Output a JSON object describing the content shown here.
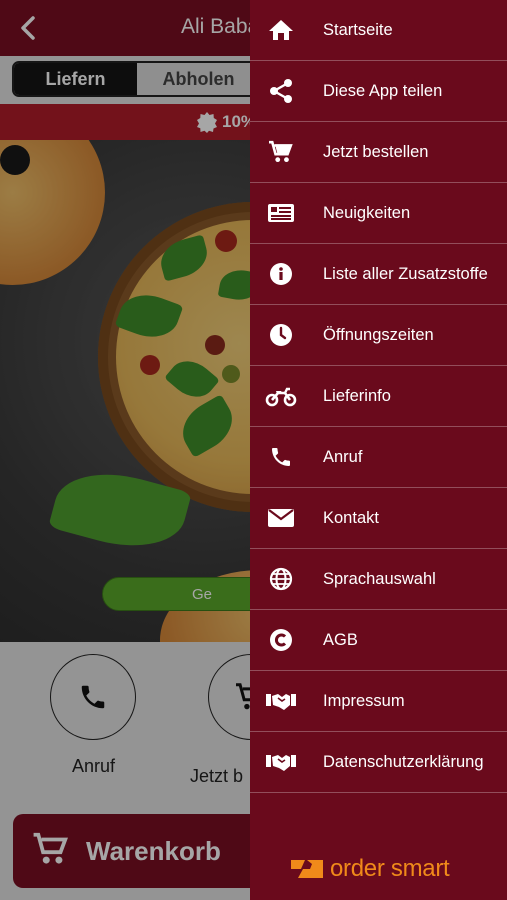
{
  "header": {
    "title": "Ali Baba"
  },
  "mode_toggle": {
    "deliver": "Liefern",
    "pickup": "Abholen"
  },
  "promo": {
    "text": "10%"
  },
  "hero": {
    "cta_label": "Ge"
  },
  "actions": [
    {
      "label": "Anruf"
    },
    {
      "label": "Jetzt b"
    }
  ],
  "cart": {
    "label": "Warenkorb"
  },
  "drawer": {
    "items": [
      {
        "label": "Startseite",
        "icon": "home-icon"
      },
      {
        "label": "Diese App teilen",
        "icon": "share-icon"
      },
      {
        "label": "Jetzt bestellen",
        "icon": "cart-icon"
      },
      {
        "label": "Neuigkeiten",
        "icon": "news-icon"
      },
      {
        "label": "Liste aller Zusatzstoffe",
        "icon": "info-icon"
      },
      {
        "label": "Öffnungszeiten",
        "icon": "clock-icon"
      },
      {
        "label": "Lieferinfo",
        "icon": "motorcycle-icon"
      },
      {
        "label": "Anruf",
        "icon": "phone-icon"
      },
      {
        "label": "Kontakt",
        "icon": "envelope-icon"
      },
      {
        "label": "Sprachauswahl",
        "icon": "globe-icon"
      },
      {
        "label": "AGB",
        "icon": "copyright-icon"
      },
      {
        "label": "Impressum",
        "icon": "handshake-icon"
      },
      {
        "label": "Datenschutzerklärung",
        "icon": "handshake-icon"
      }
    ],
    "brand": "order smart"
  },
  "colors": {
    "primary": "#7a0f22",
    "drawer": "#6a0a1c",
    "promo": "#b11d2a",
    "cta_green": "#5aa82a",
    "brand_orange": "#f08a1a"
  }
}
